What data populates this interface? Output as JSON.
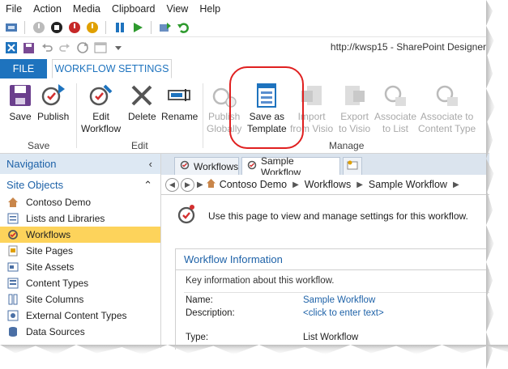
{
  "menu": [
    "File",
    "Action",
    "Media",
    "Clipboard",
    "View",
    "Help"
  ],
  "window_title": "http://kwsp15 - SharePoint Designer",
  "ribbon_tabs": {
    "file": "FILE",
    "workflow_settings": "WORKFLOW SETTINGS"
  },
  "ribbon": {
    "save": {
      "save": "Save",
      "publish": "Publish",
      "group": "Save"
    },
    "edit": {
      "edit_line1": "Edit",
      "edit_line2": "Workflow",
      "delete": "Delete",
      "rename": "Rename",
      "group": "Edit"
    },
    "manage": {
      "publish_globally_line1": "Publish",
      "publish_globally_line2": "Globally",
      "save_template_line1": "Save as",
      "save_template_line2": "Template",
      "import_line1": "Import",
      "import_line2": "from Visio",
      "export_line1": "Export",
      "export_line2": "to Visio",
      "assoc_list_line1": "Associate",
      "assoc_list_line2": "to List",
      "assoc_ct_line1": "Associate to",
      "assoc_ct_line2": "Content Type",
      "group": "Manage"
    }
  },
  "navigation": {
    "title": "Navigation",
    "site_objects": "Site Objects",
    "items": [
      {
        "label": "Contoso Demo",
        "icon": "home-icon"
      },
      {
        "label": "Lists and Libraries",
        "icon": "list-icon"
      },
      {
        "label": "Workflows",
        "icon": "workflow-icon",
        "selected": true
      },
      {
        "label": "Site Pages",
        "icon": "pages-icon"
      },
      {
        "label": "Site Assets",
        "icon": "assets-icon"
      },
      {
        "label": "Content Types",
        "icon": "content-types-icon"
      },
      {
        "label": "Site Columns",
        "icon": "columns-icon"
      },
      {
        "label": "External Content Types",
        "icon": "external-icon"
      },
      {
        "label": "Data Sources",
        "icon": "datasource-icon"
      }
    ]
  },
  "doc_tabs": {
    "workflows": "Workflows",
    "sample": "Sample Workflow"
  },
  "breadcrumb": [
    "Contoso Demo",
    "Workflows",
    "Sample Workflow"
  ],
  "intro": "Use this page to view and manage settings for this workflow.",
  "workflow_info": {
    "title": "Workflow Information",
    "description": "Key information about this workflow.",
    "name_label": "Name:",
    "name_value": "Sample Workflow",
    "desc_label": "Description:",
    "desc_value": "<click to enter text>",
    "type_label": "Type:",
    "type_value": "List Workflow"
  },
  "colors": {
    "accent": "#1e73be",
    "selected": "#fdd35b",
    "highlight_circle": "#e02020"
  }
}
